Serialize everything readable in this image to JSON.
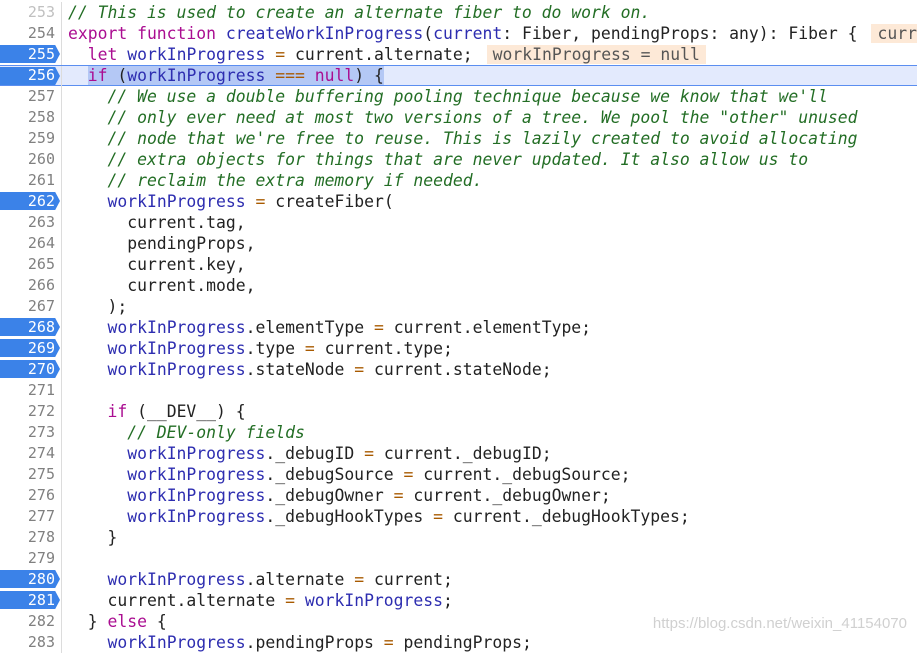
{
  "colors": {
    "breakpoint": "#3b82e8",
    "execution_line": "#e3eafd",
    "inline_value_bg": "#fde9d7",
    "comment": "#236e25",
    "keyword": "#aa0d91",
    "variable": "#2d2db0",
    "operator": "#a85a00"
  },
  "execution_line": 256,
  "lines": [
    {
      "n": "253",
      "bp": false,
      "t": [
        [
          "c",
          "// This is used to create an alternate fiber to do work on."
        ]
      ]
    },
    {
      "n": "254",
      "bp": false,
      "t": [
        [
          "k",
          "export function "
        ],
        [
          "v",
          "createWorkInProgress"
        ],
        [
          "p",
          "("
        ],
        [
          "v",
          "current"
        ],
        [
          "p",
          ": Fiber, pendingProps: any): Fiber {"
        ]
      ],
      "inline": "curr"
    },
    {
      "n": "255",
      "bp": true,
      "t": [
        [
          "p",
          "  "
        ],
        [
          "k",
          "let "
        ],
        [
          "v",
          "workInProgress "
        ],
        [
          "o",
          "= "
        ],
        [
          "p",
          "current.alternate;"
        ]
      ],
      "inline": "workInProgress = null"
    },
    {
      "n": "256",
      "bp": true,
      "t": [
        [
          "p",
          "  "
        ],
        [
          "k",
          "if "
        ],
        [
          "p",
          "("
        ],
        [
          "v",
          "workInProgress "
        ],
        [
          "o",
          "=== "
        ],
        [
          "k",
          "null"
        ],
        [
          "p",
          ") {"
        ]
      ]
    },
    {
      "n": "257",
      "bp": false,
      "t": [
        [
          "c",
          "    // We use a double buffering pooling technique because we know that we'll"
        ]
      ]
    },
    {
      "n": "258",
      "bp": false,
      "t": [
        [
          "c",
          "    // only ever need at most two versions of a tree. We pool the \"other\" unused"
        ]
      ]
    },
    {
      "n": "259",
      "bp": false,
      "t": [
        [
          "c",
          "    // node that we're free to reuse. This is lazily created to avoid allocating"
        ]
      ]
    },
    {
      "n": "260",
      "bp": false,
      "t": [
        [
          "c",
          "    // extra objects for things that are never updated. It also allow us to"
        ]
      ]
    },
    {
      "n": "261",
      "bp": false,
      "t": [
        [
          "c",
          "    // reclaim the extra memory if needed."
        ]
      ]
    },
    {
      "n": "262",
      "bp": true,
      "t": [
        [
          "p",
          "    "
        ],
        [
          "v",
          "workInProgress "
        ],
        [
          "o",
          "= "
        ],
        [
          "p",
          "createFiber("
        ]
      ]
    },
    {
      "n": "263",
      "bp": false,
      "t": [
        [
          "p",
          "      current.tag,"
        ]
      ]
    },
    {
      "n": "264",
      "bp": false,
      "t": [
        [
          "p",
          "      pendingProps,"
        ]
      ]
    },
    {
      "n": "265",
      "bp": false,
      "t": [
        [
          "p",
          "      current.key,"
        ]
      ]
    },
    {
      "n": "266",
      "bp": false,
      "t": [
        [
          "p",
          "      current.mode,"
        ]
      ]
    },
    {
      "n": "267",
      "bp": false,
      "t": [
        [
          "p",
          "    );"
        ]
      ]
    },
    {
      "n": "268",
      "bp": true,
      "t": [
        [
          "p",
          "    "
        ],
        [
          "v",
          "workInProgress"
        ],
        [
          "p",
          ".elementType "
        ],
        [
          "o",
          "= "
        ],
        [
          "p",
          "current.elementType;"
        ]
      ]
    },
    {
      "n": "269",
      "bp": true,
      "t": [
        [
          "p",
          "    "
        ],
        [
          "v",
          "workInProgress"
        ],
        [
          "p",
          ".type "
        ],
        [
          "o",
          "= "
        ],
        [
          "p",
          "current.type;"
        ]
      ]
    },
    {
      "n": "270",
      "bp": true,
      "t": [
        [
          "p",
          "    "
        ],
        [
          "v",
          "workInProgress"
        ],
        [
          "p",
          ".stateNode "
        ],
        [
          "o",
          "= "
        ],
        [
          "p",
          "current.stateNode;"
        ]
      ]
    },
    {
      "n": "271",
      "bp": false,
      "t": []
    },
    {
      "n": "272",
      "bp": false,
      "t": [
        [
          "p",
          "    "
        ],
        [
          "k",
          "if "
        ],
        [
          "p",
          "(__DEV__) {"
        ]
      ]
    },
    {
      "n": "273",
      "bp": false,
      "t": [
        [
          "c",
          "      // DEV-only fields"
        ]
      ]
    },
    {
      "n": "274",
      "bp": false,
      "t": [
        [
          "p",
          "      "
        ],
        [
          "v",
          "workInProgress"
        ],
        [
          "p",
          "._debugID "
        ],
        [
          "o",
          "= "
        ],
        [
          "p",
          "current._debugID;"
        ]
      ]
    },
    {
      "n": "275",
      "bp": false,
      "t": [
        [
          "p",
          "      "
        ],
        [
          "v",
          "workInProgress"
        ],
        [
          "p",
          "._debugSource "
        ],
        [
          "o",
          "= "
        ],
        [
          "p",
          "current._debugSource;"
        ]
      ]
    },
    {
      "n": "276",
      "bp": false,
      "t": [
        [
          "p",
          "      "
        ],
        [
          "v",
          "workInProgress"
        ],
        [
          "p",
          "._debugOwner "
        ],
        [
          "o",
          "= "
        ],
        [
          "p",
          "current._debugOwner;"
        ]
      ]
    },
    {
      "n": "277",
      "bp": false,
      "t": [
        [
          "p",
          "      "
        ],
        [
          "v",
          "workInProgress"
        ],
        [
          "p",
          "._debugHookTypes "
        ],
        [
          "o",
          "= "
        ],
        [
          "p",
          "current._debugHookTypes;"
        ]
      ]
    },
    {
      "n": "278",
      "bp": false,
      "t": [
        [
          "p",
          "    }"
        ]
      ]
    },
    {
      "n": "279",
      "bp": false,
      "t": []
    },
    {
      "n": "280",
      "bp": true,
      "t": [
        [
          "p",
          "    "
        ],
        [
          "v",
          "workInProgress"
        ],
        [
          "p",
          ".alternate "
        ],
        [
          "o",
          "= "
        ],
        [
          "p",
          "current;"
        ]
      ]
    },
    {
      "n": "281",
      "bp": true,
      "t": [
        [
          "p",
          "    current.alternate "
        ],
        [
          "o",
          "= "
        ],
        [
          "v",
          "workInProgress"
        ],
        [
          "p",
          ";"
        ]
      ]
    },
    {
      "n": "282",
      "bp": false,
      "t": [
        [
          "p",
          "  } "
        ],
        [
          "k",
          "else "
        ],
        [
          "p",
          "{"
        ]
      ]
    },
    {
      "n": "283",
      "bp": false,
      "t": [
        [
          "p",
          "    "
        ],
        [
          "v",
          "workInProgress"
        ],
        [
          "p",
          ".pendingProps "
        ],
        [
          "o",
          "= "
        ],
        [
          "p",
          "pendingProps;"
        ]
      ]
    }
  ],
  "watermark": "https://blog.csdn.net/weixin_41154070"
}
